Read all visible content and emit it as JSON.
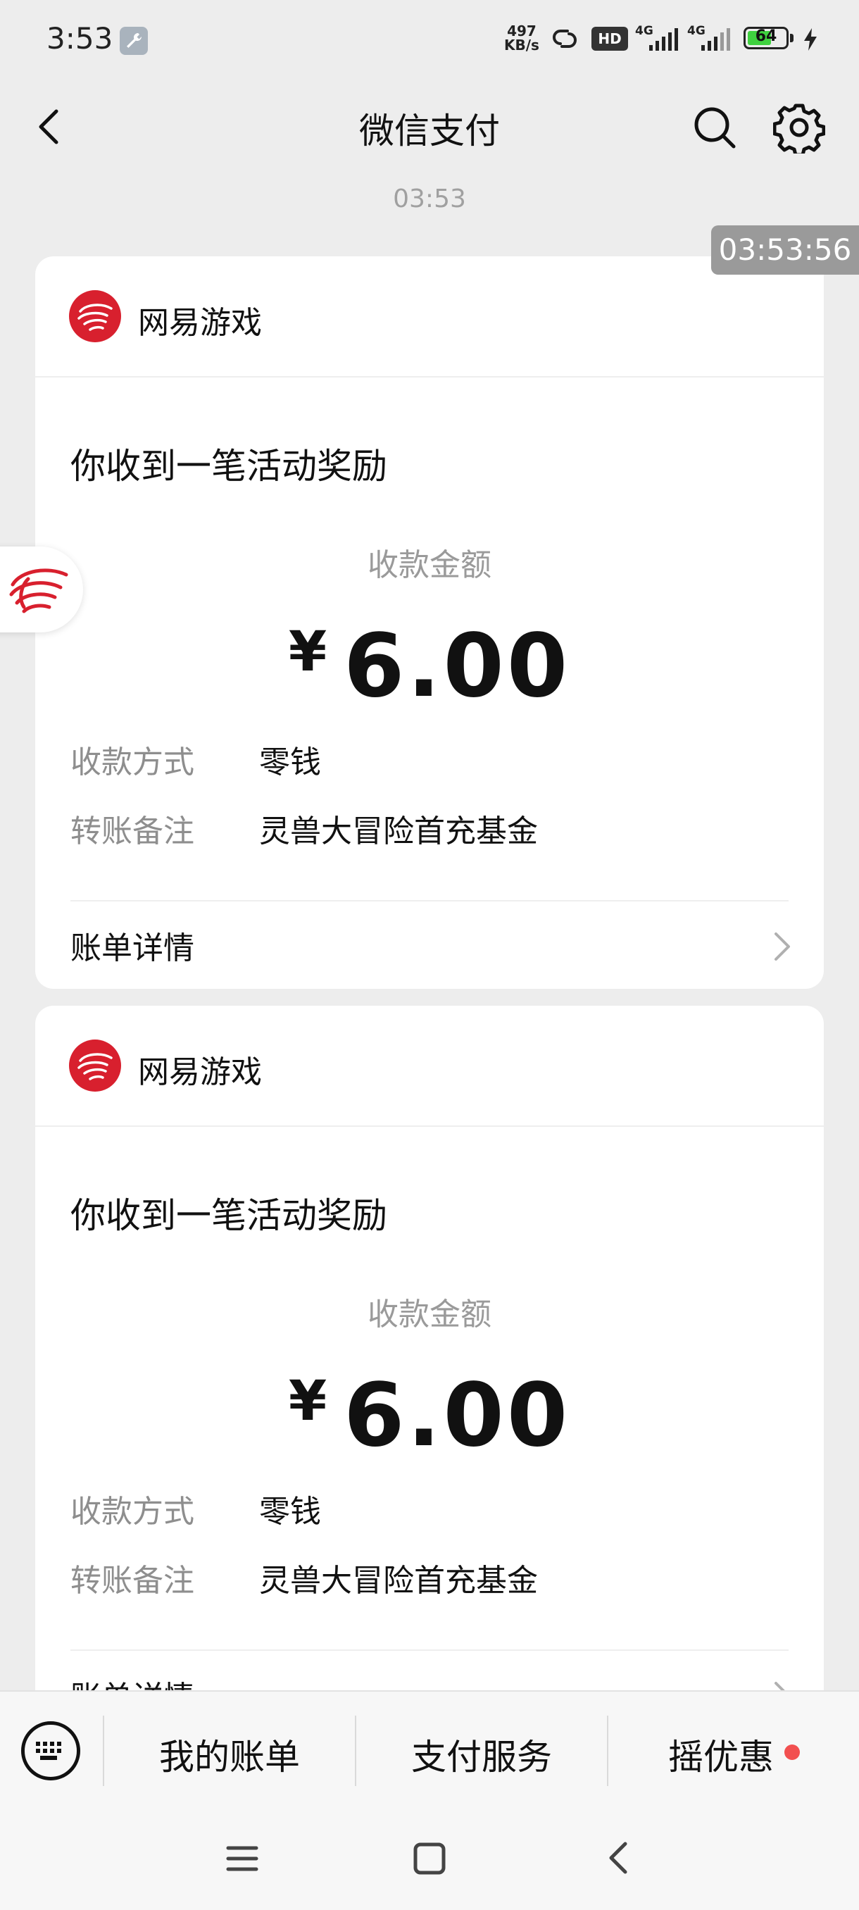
{
  "status_bar": {
    "time": "3:53",
    "net_speed_value": "497",
    "net_speed_unit": "KB/s",
    "signal_labels": [
      "HD",
      "4G",
      "4G"
    ],
    "battery": "64"
  },
  "nav": {
    "title": "微信支付",
    "back_icon": "chevron-left-icon",
    "search_icon": "search-icon",
    "settings_icon": "gear-icon"
  },
  "message_time": "03:53",
  "overlay_timestamp": "03:53:56",
  "cards": [
    {
      "merchant": "网易游戏",
      "headline": "你收到一笔活动奖励",
      "amount_label": "收款金额",
      "currency": "¥",
      "amount": "6.00",
      "rows": [
        {
          "label": "收款方式",
          "value": "零钱"
        },
        {
          "label": "转账备注",
          "value": "灵兽大冒险首充基金"
        }
      ],
      "details_label": "账单详情"
    },
    {
      "merchant": "网易游戏",
      "headline": "你收到一笔活动奖励",
      "amount_label": "收款金额",
      "currency": "¥",
      "amount": "6.00",
      "rows": [
        {
          "label": "收款方式",
          "value": "零钱"
        },
        {
          "label": "转账备注",
          "value": "灵兽大冒险首充基金"
        }
      ],
      "details_label": "账单详情"
    }
  ],
  "bottom_menu": {
    "keyboard_icon": "keyboard-icon",
    "items": [
      "我的账单",
      "支付服务",
      "摇优惠"
    ]
  },
  "colors": {
    "background": "#ededed",
    "card": "#ffffff",
    "brand_red": "#d8202e",
    "promo_dot": "#f25050",
    "battery_green": "#3fd13f"
  }
}
